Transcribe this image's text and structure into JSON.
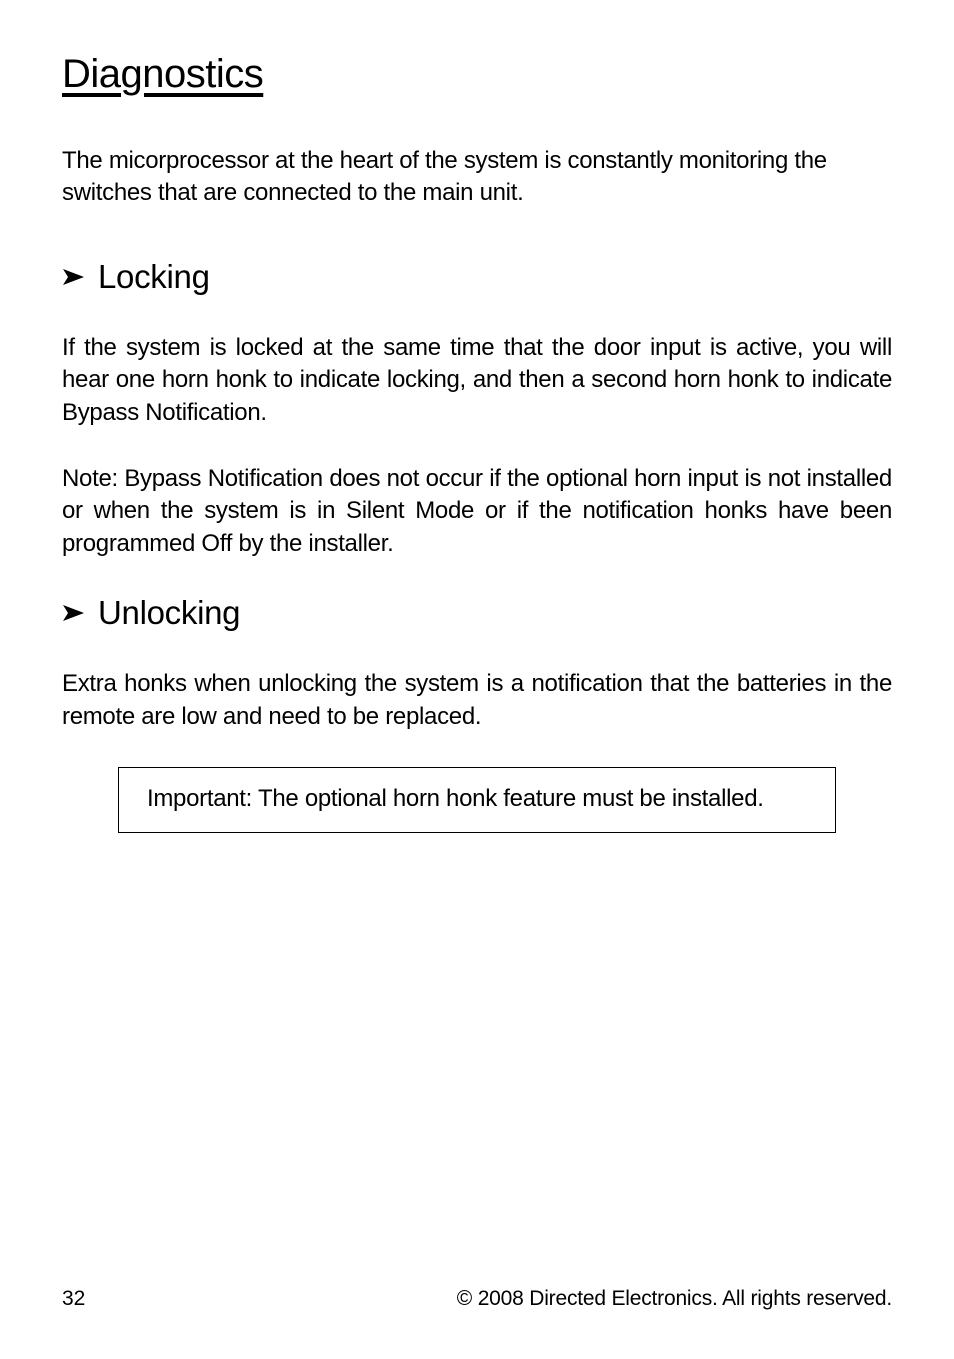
{
  "page": {
    "title": "Diagnostics",
    "intro": "The micorprocessor at the heart of the system is constantly monitoring the switches that are connected to the main unit."
  },
  "sections": {
    "locking": {
      "heading": "Locking",
      "body1": "If the system is locked at the same time that the door input is active, you will hear one horn honk to indicate locking, and then a second horn honk to indicate Bypass Notification.",
      "note_label": "Note:",
      "note_body": " Bypass Notification does not occur if the optional horn input is not installed or when the system is in Silent Mode or if the notification honks have been programmed Off by the installer."
    },
    "unlocking": {
      "heading": "Unlocking",
      "body1": "Extra honks when unlocking the system is a notification that the batteries in the remote are low and need to be replaced.",
      "callout_label": "Important:",
      "callout_body": " The optional horn honk feature must be installed."
    }
  },
  "footer": {
    "page_number": "32",
    "copyright": "© 2008 Directed Electronics. All rights reserved."
  }
}
